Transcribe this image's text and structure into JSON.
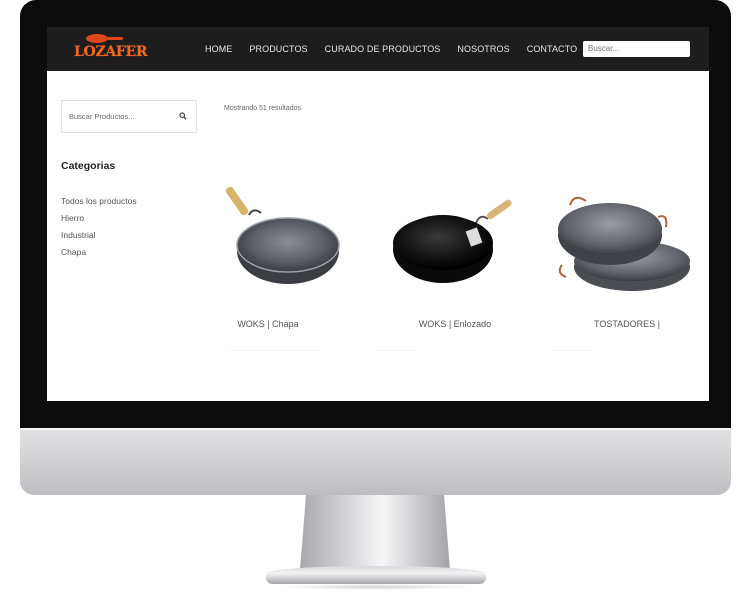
{
  "navbar": {
    "logo_text": "LOZAFER",
    "links": [
      "HOME",
      "PRODUCTOS",
      "CURADO DE PRODUCTOS",
      "NOSOTROS",
      "CONTACTO"
    ],
    "search_placeholder": "Buscar..."
  },
  "sidebar": {
    "search_placeholder": "Buscar Productos...",
    "categories_title": "Categorias",
    "categories": [
      "Todos los productos",
      "Hierro",
      "Industrial",
      "Chapa"
    ]
  },
  "results": {
    "count_text": "Mostrando 51 resultados"
  },
  "products": [
    {
      "name": "WOKS | Chapa",
      "image": "wok-chapa-image"
    },
    {
      "name": "WOKS | Enlozado",
      "image": "wok-enlozado-image"
    },
    {
      "name": "TOSTADORES |",
      "image": "tostadores-image"
    }
  ],
  "colors": {
    "navbar_bg": "#1d1d1d",
    "logo_orange": "#f06a1e",
    "bezel": "#0c0c0c"
  }
}
